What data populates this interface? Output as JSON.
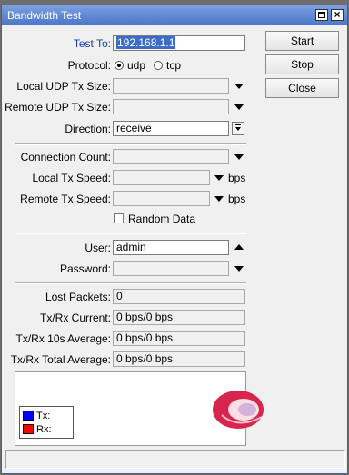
{
  "window": {
    "title": "Bandwidth Test"
  },
  "buttons": {
    "start": "Start",
    "stop": "Stop",
    "close": "Close"
  },
  "form": {
    "test_to": {
      "label": "Test To:",
      "value": "192.168.1.1"
    },
    "protocol": {
      "label": "Protocol:",
      "options": [
        "udp",
        "tcp"
      ],
      "selected": "udp"
    },
    "local_udp_tx_size": {
      "label": "Local UDP Tx Size:",
      "value": ""
    },
    "remote_udp_tx_size": {
      "label": "Remote UDP Tx Size:",
      "value": ""
    },
    "direction": {
      "label": "Direction:",
      "value": "receive"
    },
    "connection_count": {
      "label": "Connection Count:",
      "value": ""
    },
    "local_tx_speed": {
      "label": "Local Tx Speed:",
      "value": "",
      "unit": "bps"
    },
    "remote_tx_speed": {
      "label": "Remote Tx Speed:",
      "value": "",
      "unit": "bps"
    },
    "random_data": {
      "label": "Random Data",
      "checked": false
    },
    "user": {
      "label": "User:",
      "value": "admin"
    },
    "password": {
      "label": "Password:",
      "value": ""
    }
  },
  "stats": {
    "lost_packets": {
      "label": "Lost Packets:",
      "value": "0"
    },
    "txrx_current": {
      "label": "Tx/Rx Current:",
      "value": "0 bps/0 bps"
    },
    "txrx_10s_avg": {
      "label": "Tx/Rx 10s Average:",
      "value": "0 bps/0 bps"
    },
    "txrx_total_avg": {
      "label": "Tx/Rx Total Average:",
      "value": "0 bps/0 bps"
    }
  },
  "graph": {
    "legend": [
      {
        "name": "Tx:",
        "color": "#0000ff"
      },
      {
        "name": "Rx:",
        "color": "#ff0000"
      }
    ],
    "watermark_icon": "mikrotik-logo-watermark"
  }
}
